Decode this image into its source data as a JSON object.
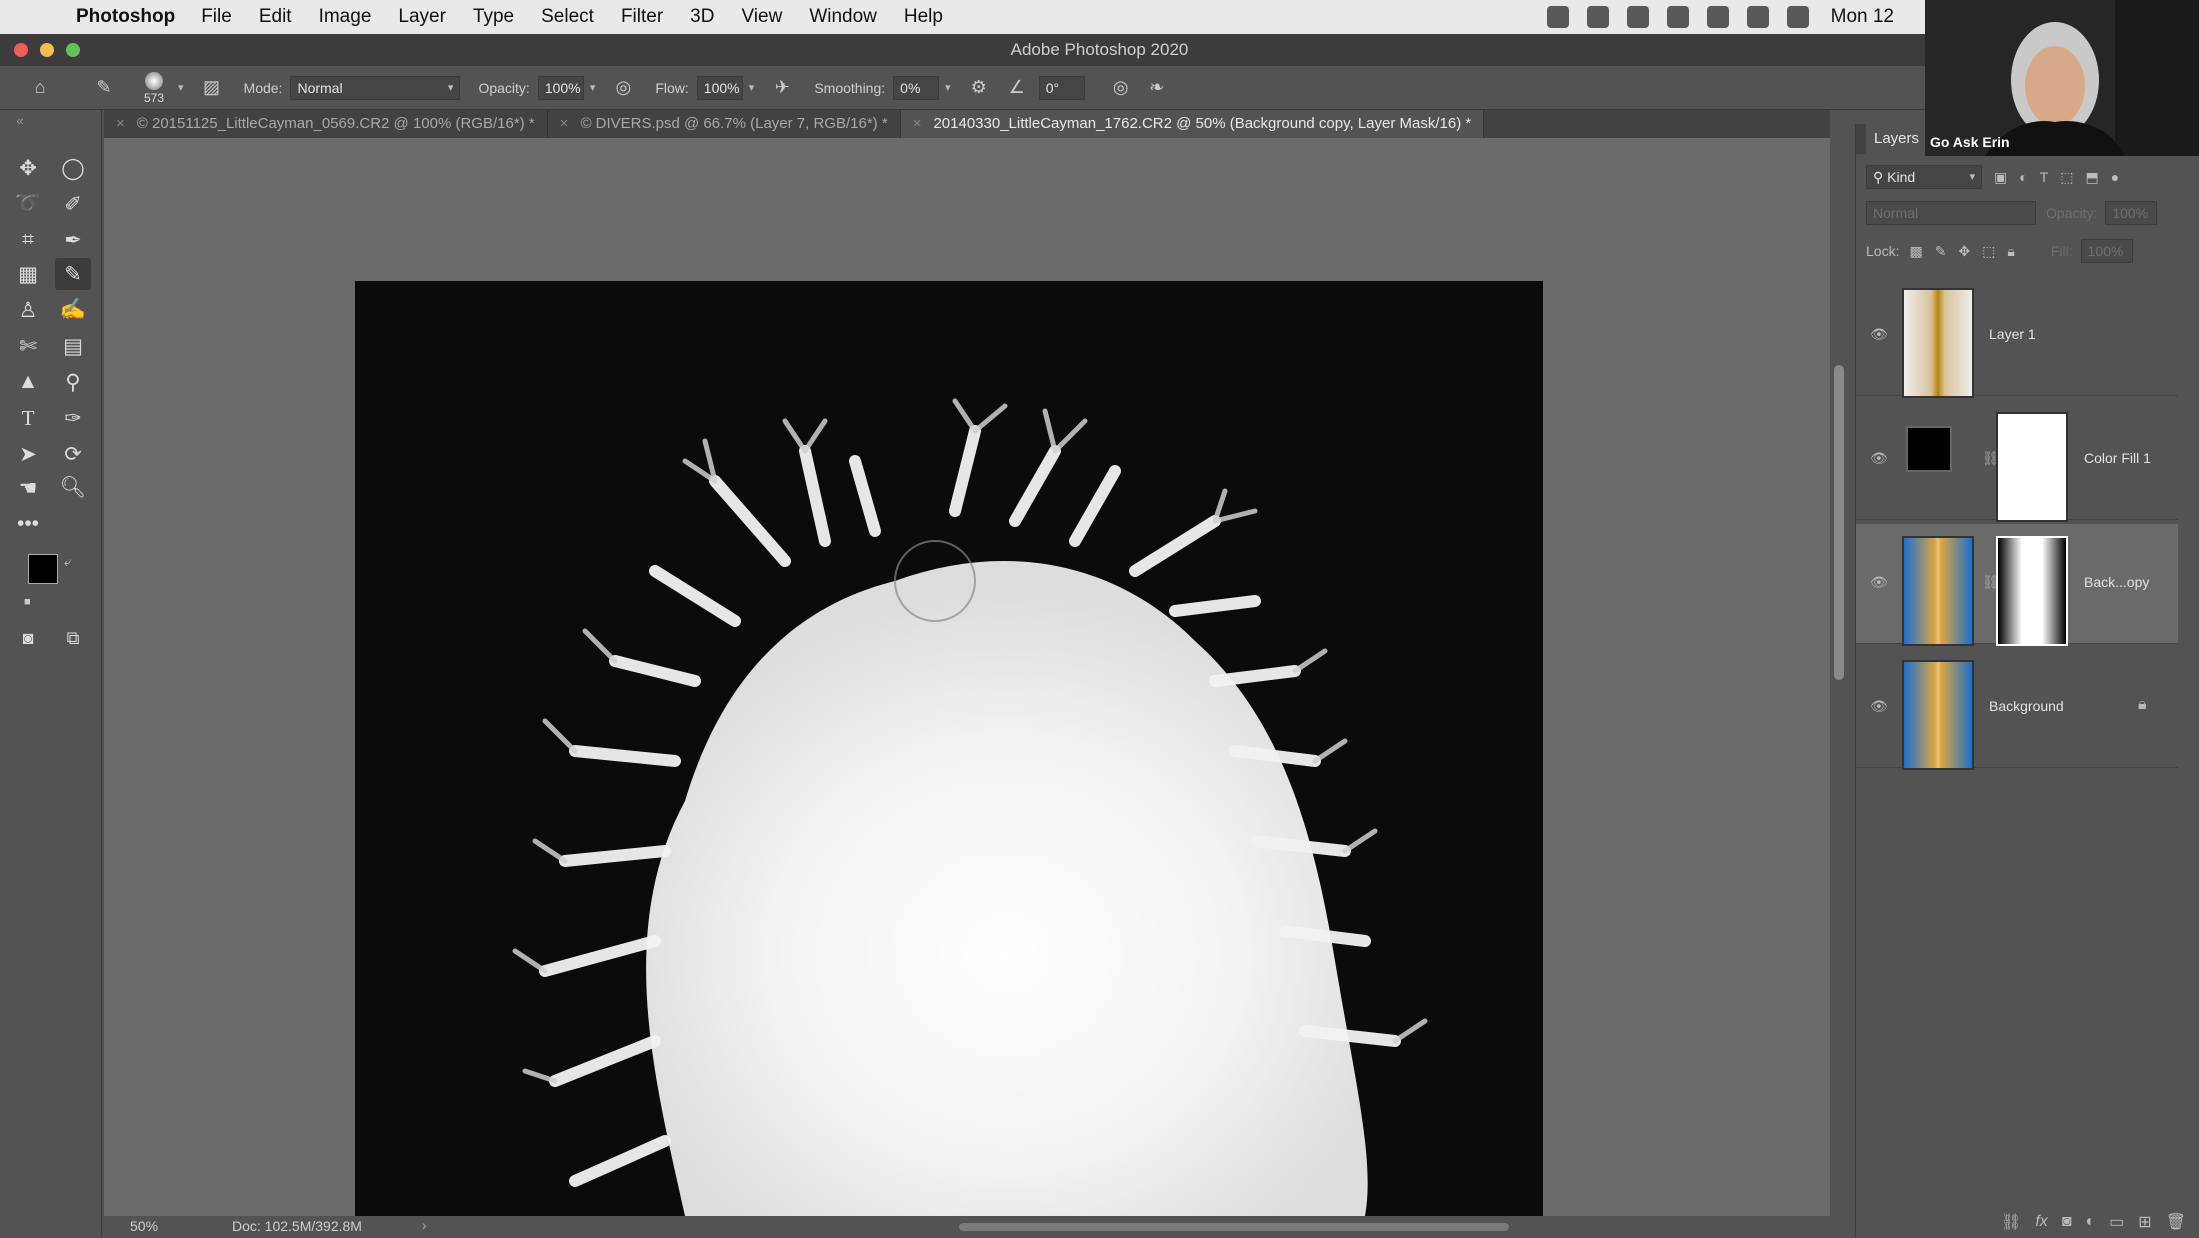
{
  "menubar": {
    "app": "Photoshop",
    "menus": [
      "File",
      "Edit",
      "Image",
      "Layer",
      "Type",
      "Select",
      "Filter",
      "3D",
      "View",
      "Window",
      "Help"
    ],
    "clock": "Mon 12"
  },
  "window": {
    "title": "Adobe Photoshop 2020"
  },
  "options": {
    "brush_size": "573",
    "mode_label": "Mode:",
    "mode_value": "Normal",
    "opacity_label": "Opacity:",
    "opacity_value": "100%",
    "flow_label": "Flow:",
    "flow_value": "100%",
    "smoothing_label": "Smoothing:",
    "smoothing_value": "0%",
    "angle_value": "0°"
  },
  "tabs": [
    {
      "label": "© 20151125_LittleCayman_0569.CR2 @ 100% (RGB/16*) *"
    },
    {
      "label": "© DIVERS.psd @ 66.7% (Layer 7, RGB/16*) *"
    },
    {
      "label": "20140330_LittleCayman_1762.CR2 @ 50% (Background copy, Layer Mask/16) *"
    }
  ],
  "status": {
    "zoom": "50%",
    "doc": "Doc: 102.5M/392.8M"
  },
  "layers_panel": {
    "tab": "Layers",
    "kind": "Kind",
    "blend": "Normal",
    "opacity_label": "Opacity:",
    "opacity_value": "100%",
    "lock_label": "Lock:",
    "fill_label": "Fill:",
    "fill_value": "100%",
    "layers": [
      {
        "name": "Layer 1"
      },
      {
        "name": "Color Fill 1"
      },
      {
        "name": "Back...opy"
      },
      {
        "name": "Background"
      }
    ]
  },
  "webcam": {
    "label": "Go Ask Erin"
  }
}
